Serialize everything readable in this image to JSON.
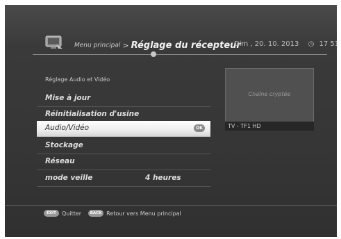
{
  "header": {
    "breadcrumb_root": "Menu principal",
    "breadcrumb_sep": ">",
    "title": "Réglage du récepteur",
    "date": "Dim , 20. 10. 2013",
    "time": "17 51",
    "clock_icon": "clock-icon",
    "tv_icon": "tv-icon"
  },
  "menu": {
    "section_label": "Réglage Audio et Vidéo",
    "items": [
      {
        "label": "Mise à jour"
      },
      {
        "label": "Réinitialisation d'usine"
      },
      {
        "label": "Audio/Vidéo",
        "badge": "OK"
      },
      {
        "label": "Stockage"
      },
      {
        "label": "Réseau"
      },
      {
        "label": "mode veille",
        "value": "4 heures"
      }
    ]
  },
  "preview": {
    "status": "Chaîne cryptée",
    "channel": "TV - TF1 HD"
  },
  "footer": {
    "exit_key": "EXIT",
    "exit_label": "Quitter",
    "back_key": "BACK",
    "back_label": "Retour vers Menu principal"
  },
  "colors": {
    "background": "#3a3a3a",
    "selected_row": "#f2f2f2",
    "text": "#dedede"
  }
}
